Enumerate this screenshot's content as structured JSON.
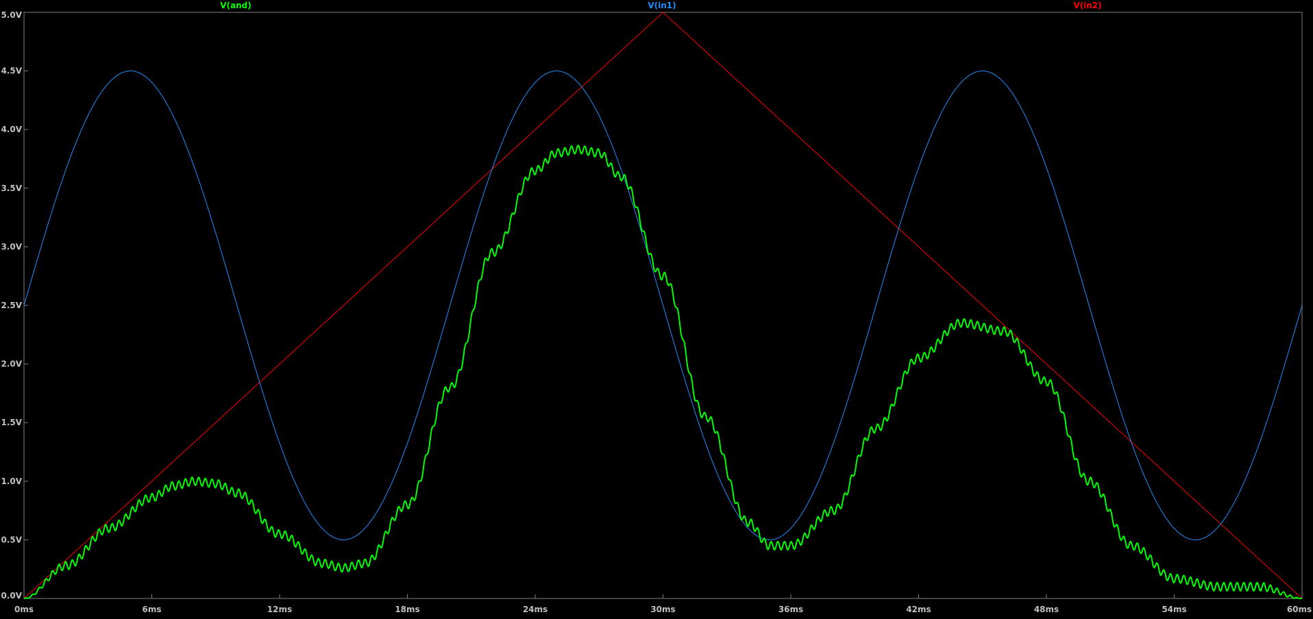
{
  "chart_data": {
    "type": "line",
    "x_tick_labels": [
      "0ms",
      "6ms",
      "12ms",
      "18ms",
      "24ms",
      "30ms",
      "36ms",
      "42ms",
      "48ms",
      "54ms",
      "60ms"
    ],
    "y_tick_labels": [
      "0.0V",
      "0.5V",
      "1.0V",
      "1.5V",
      "2.0V",
      "2.5V",
      "3.0V",
      "3.5V",
      "4.0V",
      "4.5V",
      "5.0V"
    ],
    "xlim": [
      0,
      60
    ],
    "ylim": [
      0,
      5
    ],
    "x_unit": "ms",
    "y_unit": "V",
    "grid": false,
    "legend_placement": "top",
    "background_color": "#000000",
    "axis_color": "#808080",
    "tick_label_color": "#c0c0c0",
    "series": [
      {
        "name": "V(and)",
        "color": "#00ff00",
        "x": [
          0,
          2,
          4,
          6,
          7,
          8,
          9,
          10,
          12,
          14,
          15,
          16,
          18,
          20,
          22,
          24,
          25,
          26,
          27,
          28,
          30,
          32,
          34,
          35,
          36,
          38,
          40,
          42,
          44,
          46,
          48,
          50,
          52,
          54,
          56,
          58,
          60
        ],
        "y": [
          0.0,
          0.28,
          0.6,
          0.86,
          0.96,
          1.0,
          0.98,
          0.9,
          0.55,
          0.3,
          0.26,
          0.3,
          0.8,
          1.8,
          2.95,
          3.65,
          3.8,
          3.83,
          3.8,
          3.6,
          2.75,
          1.55,
          0.65,
          0.45,
          0.45,
          0.75,
          1.45,
          2.05,
          2.35,
          2.28,
          1.85,
          1.0,
          0.45,
          0.17,
          0.1,
          0.1,
          0.0
        ]
      },
      {
        "name": "V(in1)",
        "color": "#1e90ff",
        "form": "sine",
        "offset": 2.5,
        "amplitude": 2.0,
        "period_ms": 20,
        "phase_deg": 0
      },
      {
        "name": "V(in2)",
        "color": "#ff0000",
        "x": [
          0,
          30,
          60
        ],
        "y": [
          0.0,
          5.0,
          0.0
        ]
      }
    ]
  }
}
